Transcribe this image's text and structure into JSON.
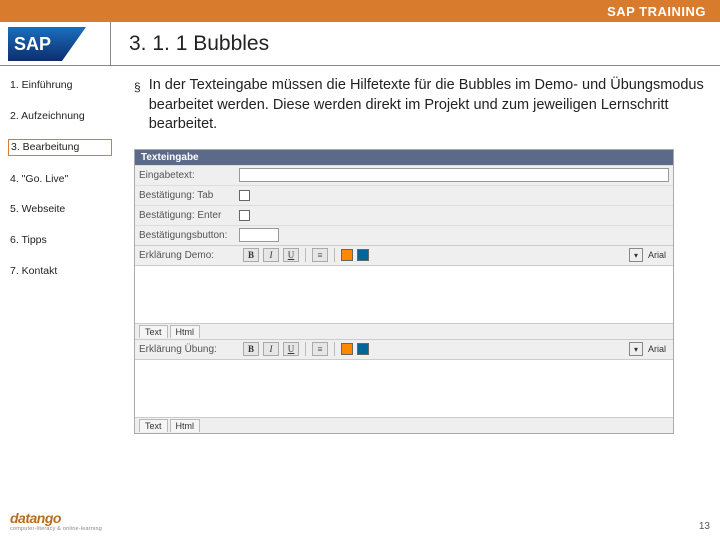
{
  "header": {
    "app_title": "SAP TRAINING",
    "heading": "3. 1. 1 Bubbles"
  },
  "sidebar": {
    "items": [
      {
        "label": "1. Einführung",
        "active": false
      },
      {
        "label": "2. Aufzeichnung",
        "active": false
      },
      {
        "label": "3. Bearbeitung",
        "active": true
      },
      {
        "label": "4. \"Go. Live\"",
        "active": false
      },
      {
        "label": "5. Webseite",
        "active": false
      },
      {
        "label": "6. Tipps",
        "active": false
      },
      {
        "label": "7. Kontakt",
        "active": false
      }
    ]
  },
  "content": {
    "bullet_glyph": "§",
    "bullet_text": "In der Texteingabe müssen die Hilfetexte für die Bubbles im Demo- und Übungsmodus bearbeitet werden. Diese werden direkt im Projekt und zum jeweiligen Lernschritt bearbeitet."
  },
  "dialog": {
    "title": "Texteingabe",
    "rows": {
      "eingabetext": "Eingabetext:",
      "best_tab": "Bestätigung: Tab",
      "best_enter": "Bestätigung: Enter",
      "best_button": "Bestätigungsbutton:",
      "erkl_demo": "Erklärung Demo:",
      "erkl_uebung": "Erklärung Übung:"
    },
    "toolbar": {
      "bold": "B",
      "italic": "I",
      "underline": "U",
      "font_selected": "Arial",
      "tabs": {
        "text": "Text",
        "html": "Html"
      }
    }
  },
  "footer": {
    "brand": "datango",
    "tagline": "computer-literacy & online-learning",
    "page_number": "13"
  }
}
